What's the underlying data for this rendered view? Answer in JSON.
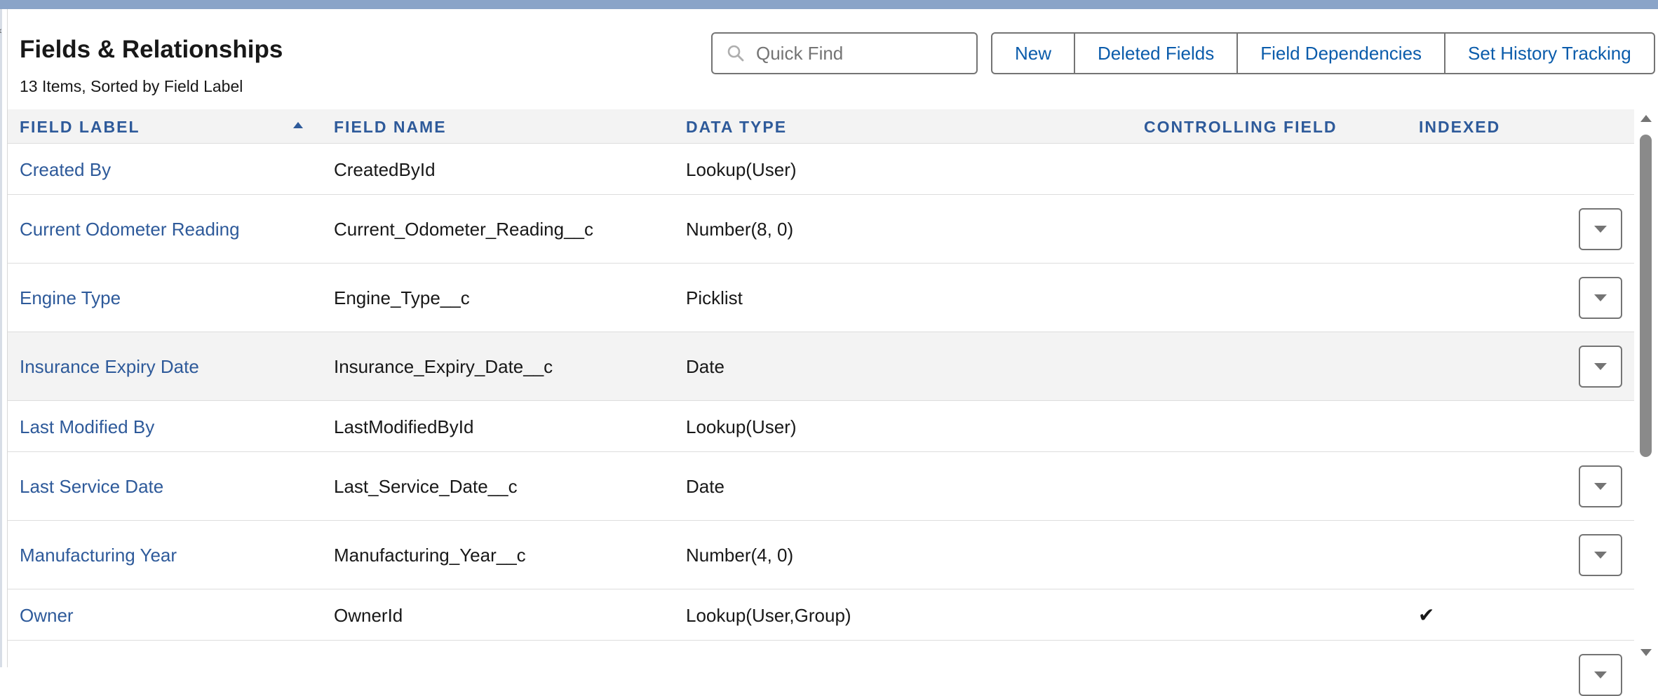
{
  "header": {
    "title": "Fields & Relationships",
    "subtitle": "13 Items, Sorted by Field Label"
  },
  "search": {
    "placeholder": "Quick Find",
    "value": "",
    "icon": "search-icon"
  },
  "actions": {
    "new_label": "New",
    "deleted_fields_label": "Deleted Fields",
    "field_dependencies_label": "Field Dependencies",
    "set_history_tracking_label": "Set History Tracking"
  },
  "table": {
    "sorted_by": "Field Label",
    "sort_direction": "ascending",
    "columns": {
      "field_label": "FIELD LABEL",
      "field_name": "FIELD NAME",
      "data_type": "DATA TYPE",
      "controlling_field": "CONTROLLING FIELD",
      "indexed": "INDEXED"
    },
    "rows": [
      {
        "label": "Created By",
        "name": "CreatedById",
        "type": "Lookup(User)",
        "controlling": "",
        "indexed": false,
        "has_actions": false
      },
      {
        "label": "Current Odometer Reading",
        "name": "Current_Odometer_Reading__c",
        "type": "Number(8, 0)",
        "controlling": "",
        "indexed": false,
        "has_actions": true
      },
      {
        "label": "Engine Type",
        "name": "Engine_Type__c",
        "type": "Picklist",
        "controlling": "",
        "indexed": false,
        "has_actions": true
      },
      {
        "label": "Insurance Expiry Date",
        "name": "Insurance_Expiry_Date__c",
        "type": "Date",
        "controlling": "",
        "indexed": false,
        "has_actions": true
      },
      {
        "label": "Last Modified By",
        "name": "LastModifiedById",
        "type": "Lookup(User)",
        "controlling": "",
        "indexed": false,
        "has_actions": false
      },
      {
        "label": "Last Service Date",
        "name": "Last_Service_Date__c",
        "type": "Date",
        "controlling": "",
        "indexed": false,
        "has_actions": true
      },
      {
        "label": "Manufacturing Year",
        "name": "Manufacturing_Year__c",
        "type": "Number(4, 0)",
        "controlling": "",
        "indexed": false,
        "has_actions": true
      },
      {
        "label": "Owner",
        "name": "OwnerId",
        "type": "Lookup(User,Group)",
        "controlling": "",
        "indexed": true,
        "has_actions": false
      }
    ]
  },
  "colors": {
    "link": "#2e5a9a",
    "button_text": "#0b5cab",
    "border": "#747474",
    "header_bg": "#f3f3f3",
    "top_band": "#8aa4c8"
  }
}
